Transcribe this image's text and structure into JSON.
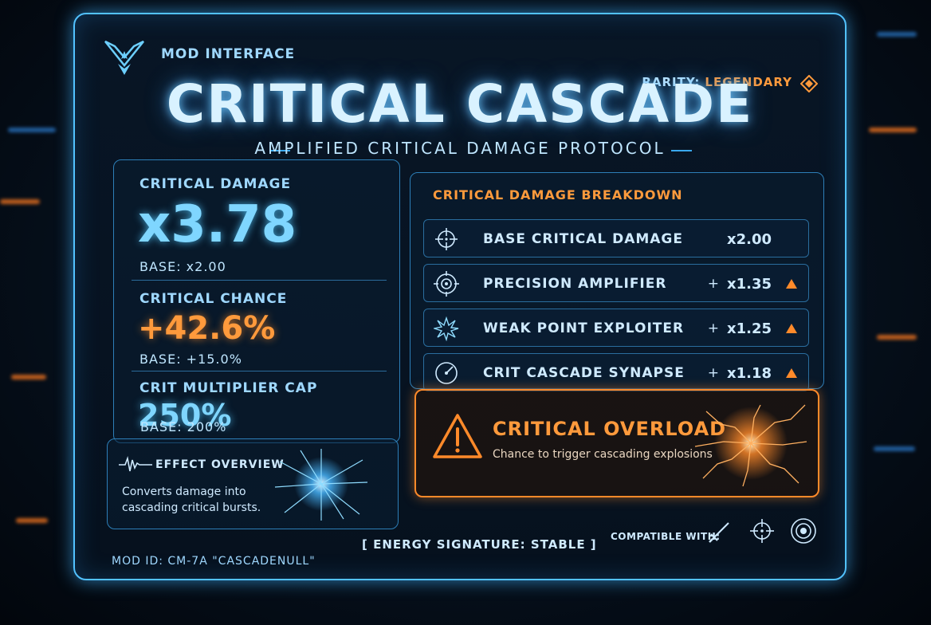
{
  "header": {
    "mod_interface": "MOD INTERFACE",
    "rarity_label": "RARITY:",
    "rarity_value": "LEGENDARY",
    "title": "CRITICAL CASCADE",
    "subtitle": "AMPLIFIED CRITICAL DAMAGE PROTOCOL"
  },
  "stats": {
    "critical_damage": {
      "label": "CRITICAL DAMAGE",
      "value": "x3.78",
      "base": "BASE: x2.00"
    },
    "critical_chance": {
      "label": "CRITICAL CHANCE",
      "value": "+42.6%",
      "base": "BASE: +15.0%"
    },
    "crit_cap": {
      "label": "CRIT MULTIPLIER CAP",
      "value": "250%",
      "base": "BASE: 200%"
    }
  },
  "effect": {
    "title": "EFFECT OVERVIEW",
    "text": "Converts damage into cascading critical bursts."
  },
  "breakdown": {
    "title": "CRITICAL DAMAGE BREAKDOWN",
    "rows": [
      {
        "label": "BASE CRITICAL DAMAGE",
        "plus": "",
        "value": "x2.00",
        "icon": "crosshair-icon",
        "increase": false
      },
      {
        "label": "PRECISION AMPLIFIER",
        "plus": "+",
        "value": "x1.35",
        "icon": "target-icon",
        "increase": true
      },
      {
        "label": "WEAK POINT EXPLOITER",
        "plus": "+",
        "value": "x1.25",
        "icon": "shatter-icon",
        "increase": true
      },
      {
        "label": "CRIT CASCADE SYNAPSE",
        "plus": "+",
        "value": "x1.18",
        "icon": "gauge-icon",
        "increase": true
      }
    ]
  },
  "overload": {
    "title": "CRITICAL OVERLOAD",
    "text": "Chance to trigger cascading explosions"
  },
  "footer": {
    "mod_id": "MOD ID: CM-7A \"CASCADENULL\"",
    "energy": "[ ENERGY SIGNATURE: STABLE ]",
    "compatible": "COMPATIBLE WITH:",
    "compatible_icons": [
      "sword-icon",
      "crosshair-icon",
      "scope-icon"
    ]
  },
  "colors": {
    "accent_cyan": "#52c2ff",
    "accent_orange": "#ff9a3c",
    "background": "#06101c"
  }
}
